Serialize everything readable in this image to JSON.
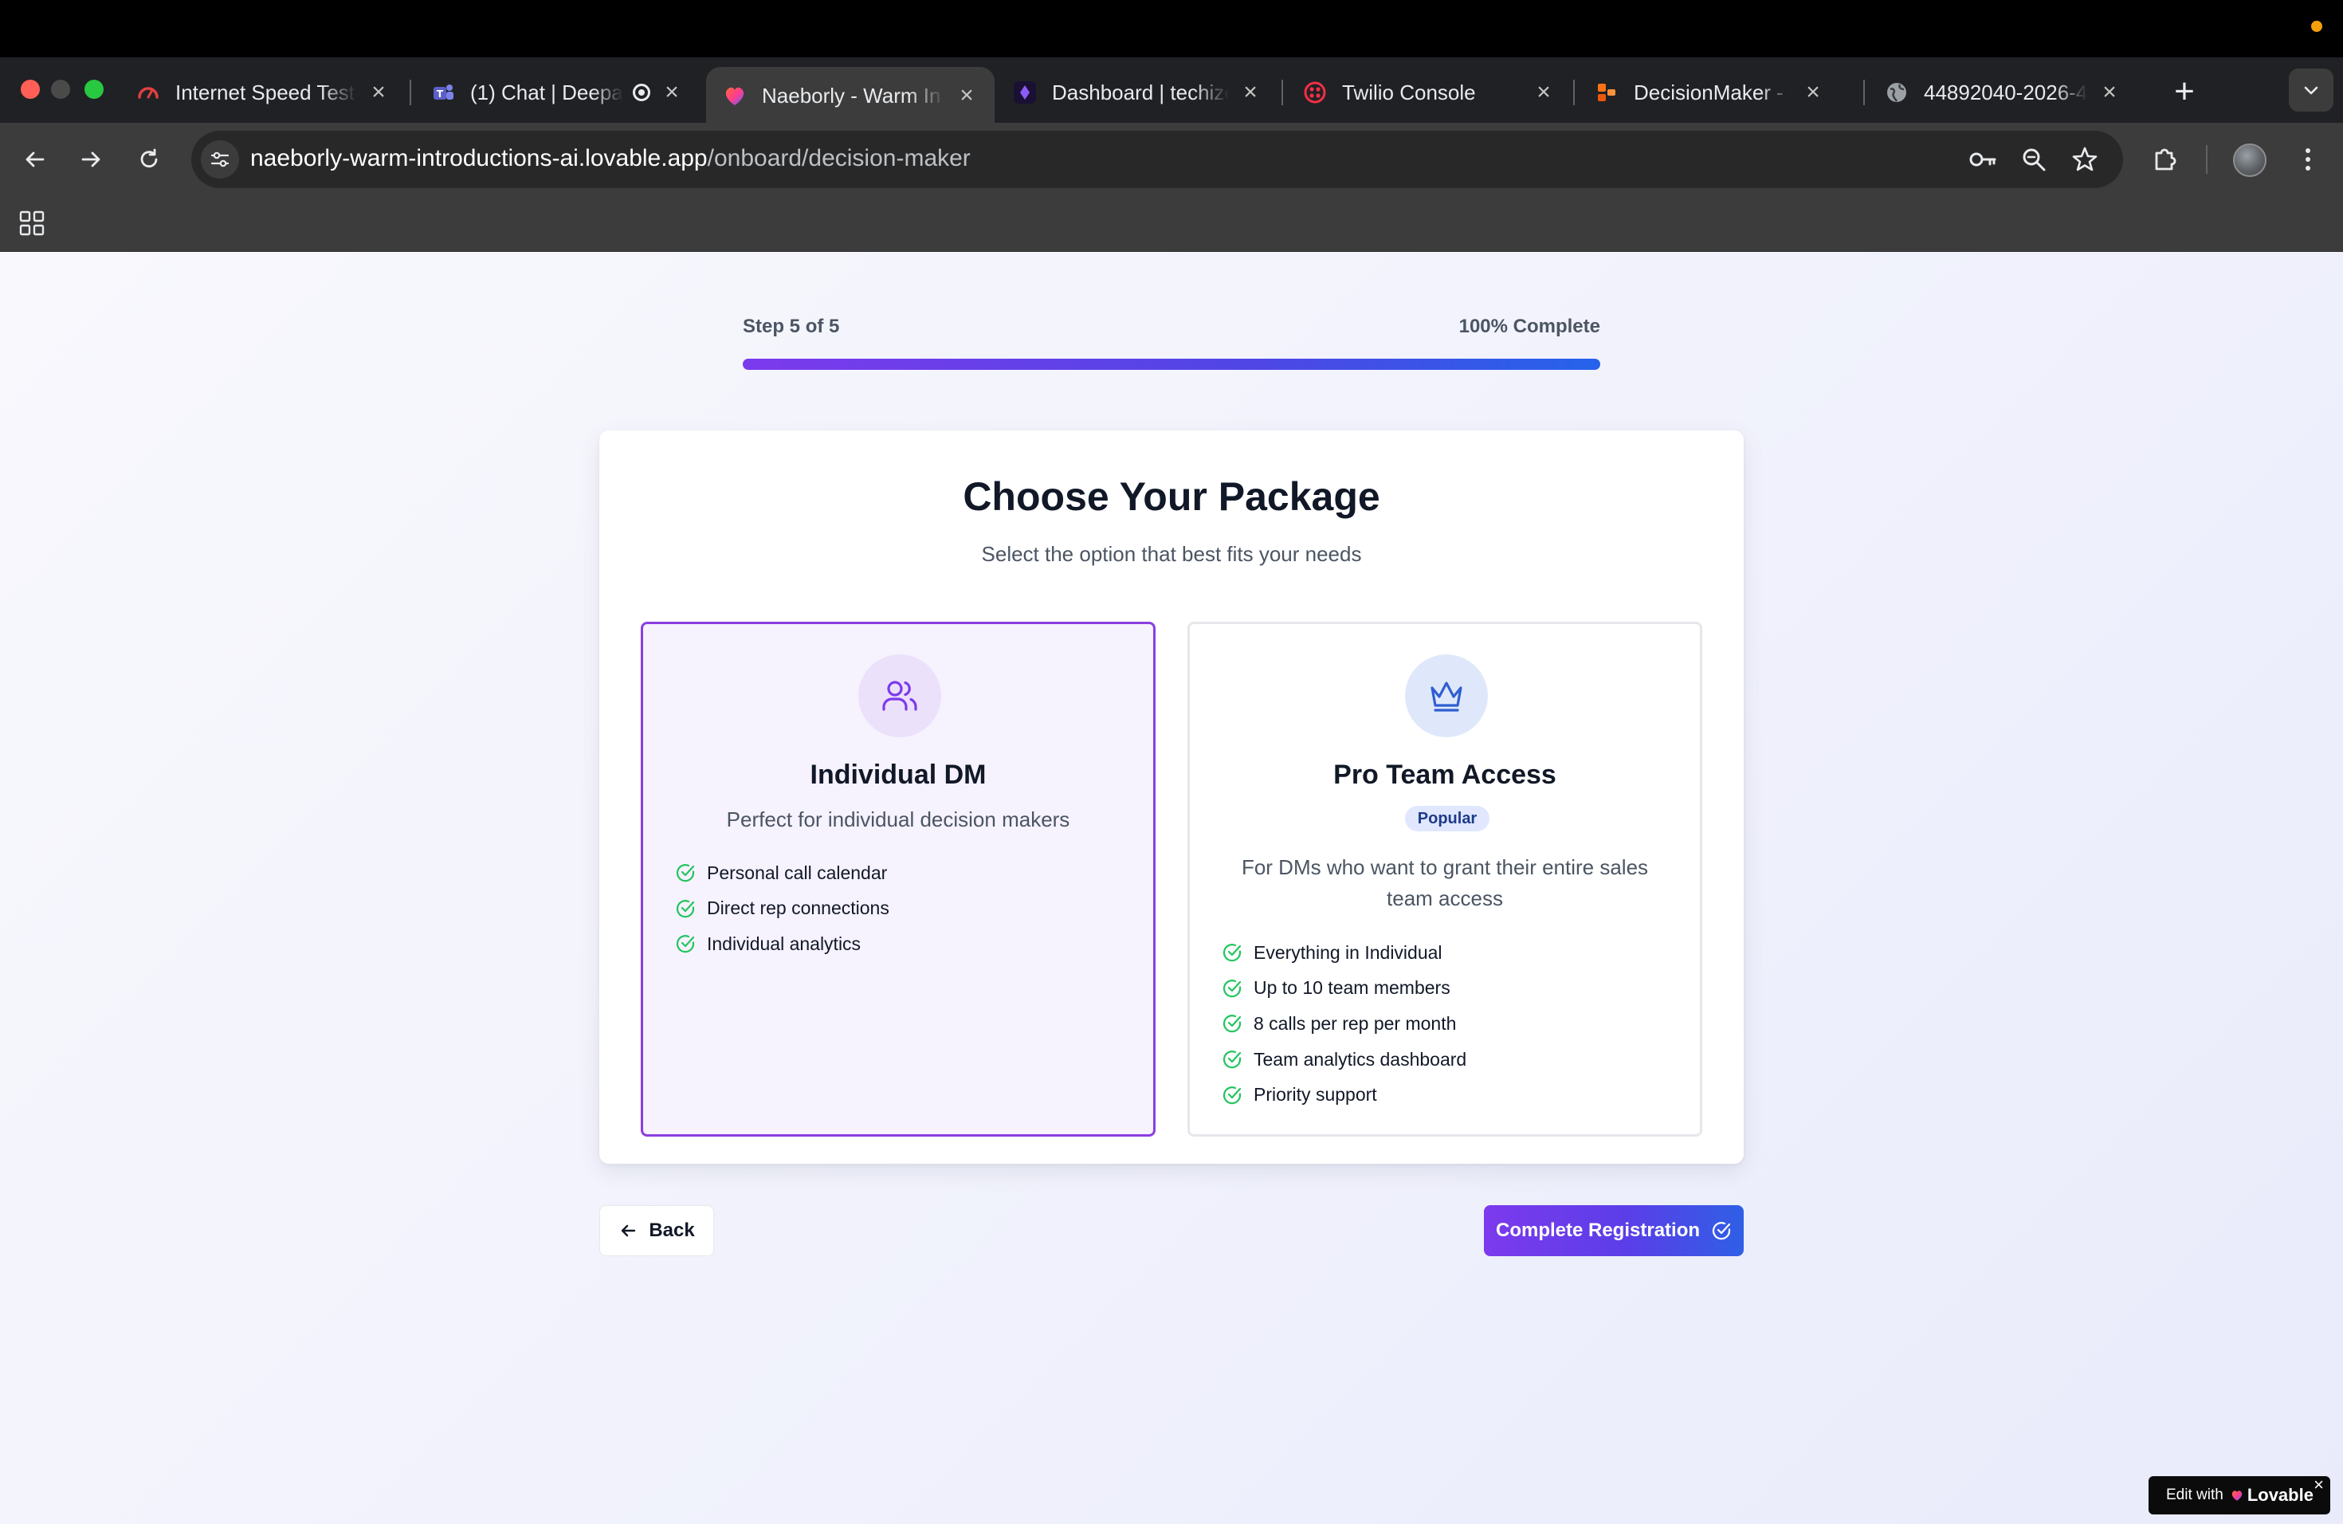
{
  "browser": {
    "tabs": [
      {
        "title": "Internet Speed Test",
        "icon": "gauge-icon",
        "active": false
      },
      {
        "title": "(1) Chat | Deepa",
        "icon": "teams-icon",
        "active": false
      },
      {
        "title": "Naeborly - Warm In",
        "icon": "lovable-heart-icon",
        "active": true
      },
      {
        "title": "Dashboard | techize",
        "icon": "dashboard-app-icon",
        "active": false
      },
      {
        "title": "Twilio Console",
        "icon": "twilio-icon",
        "active": false
      },
      {
        "title": "DecisionMaker - Re",
        "icon": "decisionmaker-icon",
        "active": false
      },
      {
        "title": "44892040-2026-4",
        "icon": "globe-icon",
        "active": false
      }
    ],
    "new_tab_label": "+",
    "url_host": "naeborly-warm-introductions-ai.lovable.app",
    "url_path": "/onboard/decision-maker"
  },
  "progress": {
    "step_text": "Step 5 of 5",
    "percent_text": "100% Complete",
    "value": 1.0
  },
  "card": {
    "title": "Choose Your Package",
    "subtitle": "Select the option that best fits your needs"
  },
  "packages": [
    {
      "name": "Individual DM",
      "icon": "users-icon",
      "description": "Perfect for individual decision makers",
      "selected": true,
      "features": [
        "Personal call calendar",
        "Direct rep connections",
        "Individual analytics"
      ]
    },
    {
      "name": "Pro Team Access",
      "icon": "crown-icon",
      "badge": "Popular",
      "description": "For DMs who want to grant their entire sales team access",
      "selected": false,
      "features": [
        "Everything in Individual",
        "Up to 10 team members",
        "8 calls per rep per month",
        "Team analytics dashboard",
        "Priority support"
      ]
    }
  ],
  "actions": {
    "back_label": "Back",
    "complete_label": "Complete Registration"
  },
  "lovable_badge": {
    "prefix": "Edit with",
    "brand": "Lovable",
    "close": "×"
  },
  "colors": {
    "accent_purple": "#7c3aed",
    "accent_blue": "#2563eb",
    "selected_border": "#8b3fe0",
    "check_green": "#22c55e"
  }
}
